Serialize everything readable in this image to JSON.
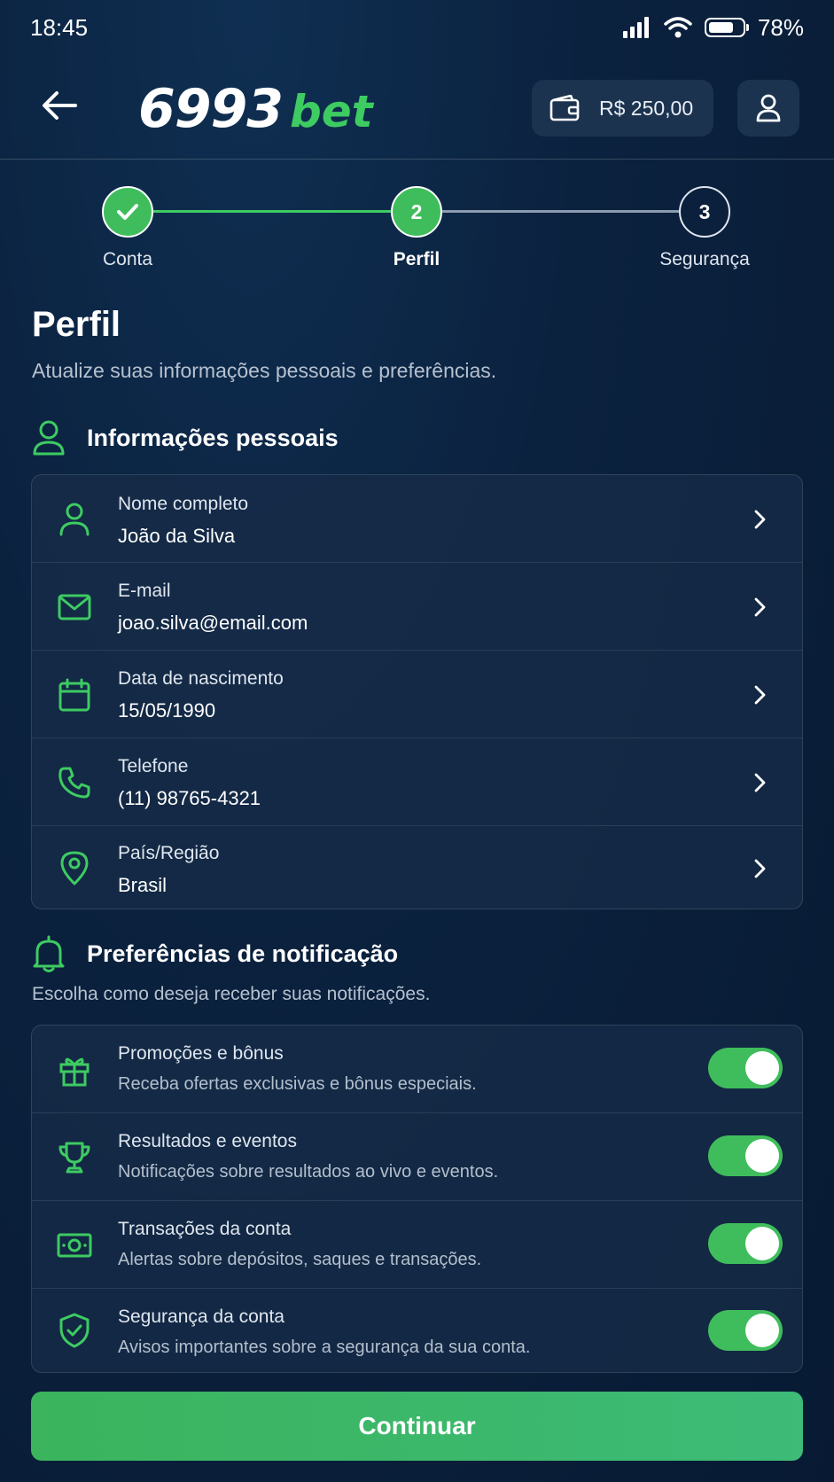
{
  "status_bar": {
    "time": "18:45",
    "battery": "78%",
    "battery_level": 0.78
  },
  "header": {
    "logo_number": "6993",
    "logo_word": "bet",
    "wallet_balance": "R$ 250,00"
  },
  "stepper": {
    "steps": [
      {
        "label": "Conta",
        "number": "",
        "state": "done"
      },
      {
        "label": "Perfil",
        "number": "2",
        "state": "active"
      },
      {
        "label": "Segurança",
        "number": "3",
        "state": "pending"
      }
    ]
  },
  "page": {
    "title": "Perfil",
    "subtitle": "Atualize suas informações pessoais e preferências."
  },
  "personal": {
    "title": "Informações pessoais",
    "items": [
      {
        "label": "Nome completo",
        "value": "João da Silva",
        "icon": "user-icon"
      },
      {
        "label": "E-mail",
        "value": "joao.silva@email.com",
        "icon": "mail-icon"
      },
      {
        "label": "Data de nascimento",
        "value": "15/05/1990",
        "icon": "calendar-icon"
      },
      {
        "label": "Telefone",
        "value": "(11) 98765-4321",
        "icon": "phone-icon"
      },
      {
        "label": "País/Região",
        "value": "Brasil",
        "icon": "location-pin-icon"
      }
    ]
  },
  "notifications": {
    "title": "Preferências de notificação",
    "subtitle": "Escolha como deseja receber suas notificações.",
    "items": [
      {
        "label": "Promoções e bônus",
        "desc": "Receba ofertas exclusivas e bônus especiais.",
        "icon": "gift-icon",
        "enabled": true
      },
      {
        "label": "Resultados e eventos",
        "desc": "Notificações sobre resultados ao vivo e eventos.",
        "icon": "trophy-icon",
        "enabled": true
      },
      {
        "label": "Transações da conta",
        "desc": "Alertas sobre depósitos, saques e transações.",
        "icon": "money-icon",
        "enabled": true
      },
      {
        "label": "Segurança da conta",
        "desc": "Avisos importantes sobre a segurança da sua conta.",
        "icon": "shield-check-icon",
        "enabled": true
      }
    ]
  },
  "actions": {
    "continue_label": "Continuar"
  },
  "colors": {
    "accent": "#3dcb62",
    "background": "#0b223f",
    "card": "#172c48"
  }
}
